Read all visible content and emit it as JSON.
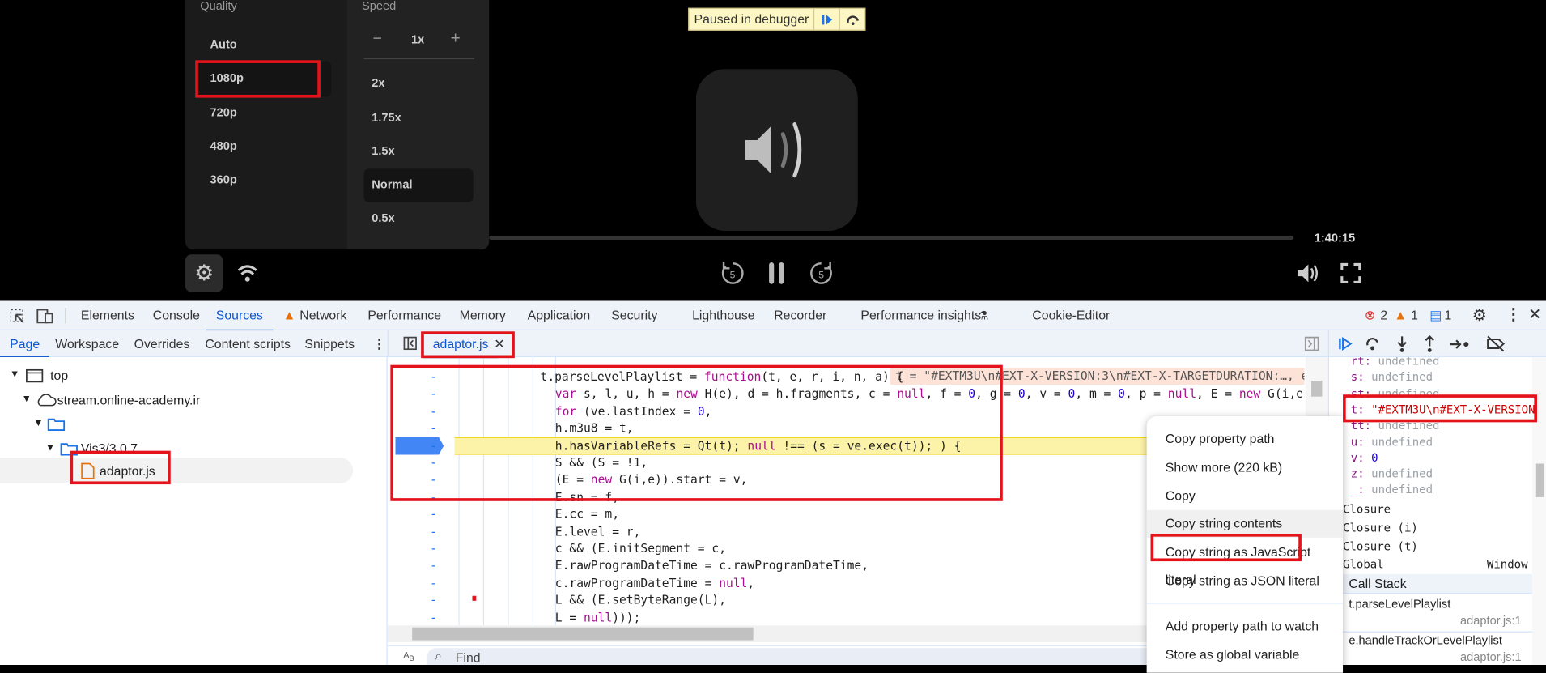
{
  "player": {
    "quality_header": "Quality",
    "speed_header": "Speed",
    "quality_options": [
      "Auto",
      "1080p",
      "720p",
      "480p",
      "360p"
    ],
    "speed_stepper": {
      "minus": "−",
      "value": "1x",
      "plus": "+"
    },
    "speed_options": [
      "2x",
      "1.75x",
      "1.5x",
      "Normal",
      "0.5x"
    ],
    "selected_quality": "1080p",
    "selected_speed": "Normal",
    "time": "1:40:15",
    "paused_label": "Paused in debugger",
    "rewind_seconds": "5",
    "forward_seconds": "5"
  },
  "devtools": {
    "tabs": [
      "Elements",
      "Console",
      "Sources",
      "Network",
      "Performance",
      "Memory",
      "Application",
      "Security",
      "Lighthouse",
      "Recorder",
      "Performance insights",
      "Cookie-Editor"
    ],
    "active_tab": "Sources",
    "errors": "2",
    "warnings": "1",
    "messages": "1",
    "nav_tabs": [
      "Page",
      "Workspace",
      "Overrides",
      "Content scripts",
      "Snippets"
    ],
    "tree": {
      "top": "top",
      "domain": "stream.online-academy.ir",
      "folder": "Vis3/3.0.7",
      "file": "adaptor.js"
    },
    "open_file": "adaptor.js",
    "inline_value": "t = \"#EXTM3U\\n#EXT-X-VERSION:3\\n#EXT-X-TARGETDURATION:…, e",
    "code": [
      [
        [
          "t.parseLevelPlaylist = ",
          ""
        ],
        [
          "function",
          "kw"
        ],
        [
          "(t, e, r, i, n, a) {",
          ""
        ]
      ],
      [
        [
          "var",
          "kw"
        ],
        [
          " s, l, u, h = ",
          ""
        ],
        [
          "new",
          "kw"
        ],
        [
          " H(e), d = h.fragments, c = ",
          ""
        ],
        [
          "null",
          "kw"
        ],
        [
          ", f = ",
          ""
        ],
        [
          "0",
          "nm"
        ],
        [
          ", g = ",
          ""
        ],
        [
          "0",
          "nm"
        ],
        [
          ", v = ",
          ""
        ],
        [
          "0",
          "nm"
        ],
        [
          ", m = ",
          ""
        ],
        [
          "0",
          "nm"
        ],
        [
          ", p = ",
          ""
        ],
        [
          "null",
          "kw"
        ],
        [
          ", E = ",
          ""
        ],
        [
          "new",
          "kw"
        ],
        [
          " G(i,e), T = ",
          ""
        ]
      ],
      [
        [
          "for",
          "kw"
        ],
        [
          " (ve.lastIndex = ",
          ""
        ],
        [
          "0",
          "nm"
        ],
        [
          ",",
          ""
        ]
      ],
      [
        [
          "h.m3u8 = t,",
          ""
        ]
      ],
      [
        [
          "h.hasVariableRefs = Qt(t); ",
          ""
        ],
        [
          "null",
          "kw"
        ],
        [
          " !== (s = ve.exec(t)); ) {",
          ""
        ]
      ],
      [
        [
          "S && (S = !1,",
          ""
        ]
      ],
      [
        [
          "(E = ",
          ""
        ],
        [
          "new",
          "kw"
        ],
        [
          " G(i,e)).start = v,",
          ""
        ]
      ],
      [
        [
          "E.sn = f,",
          ""
        ]
      ],
      [
        [
          "E.cc = m,",
          ""
        ]
      ],
      [
        [
          "E.level = r,",
          ""
        ]
      ],
      [
        [
          "c && (E.initSegment = c,",
          ""
        ]
      ],
      [
        [
          "E.rawProgramDateTime = c.rawProgramDateTime,",
          ""
        ]
      ],
      [
        [
          "c.rawProgramDateTime = ",
          ""
        ],
        [
          "null",
          "kw"
        ],
        [
          ",",
          ""
        ]
      ],
      [
        [
          "L && (E.setByteRange(L),",
          ""
        ]
      ],
      [
        [
          "L = ",
          ""
        ],
        [
          "null",
          "kw"
        ],
        [
          ")));",
          ""
        ]
      ]
    ],
    "find_placeholder": "Find",
    "scope": [
      {
        "k": "rt",
        "v": "undefined"
      },
      {
        "k": "s",
        "v": "undefined"
      },
      {
        "k": "st",
        "v": "undefined"
      },
      {
        "k": "t",
        "v": "\"#EXTM3U\\n#EXT-X-VERSION"
      },
      {
        "k": "tt",
        "v": "undefined"
      },
      {
        "k": "u",
        "v": "undefined"
      },
      {
        "k": "v",
        "v": "0"
      },
      {
        "k": "z",
        "v": "undefined"
      },
      {
        "k": "_",
        "v": "undefined"
      }
    ],
    "closures": [
      "Closure",
      "Closure (i)",
      "Closure (t)"
    ],
    "global": {
      "label": "Global",
      "value": "Window"
    },
    "call_stack_header": "Call Stack",
    "call_stack": [
      {
        "fn": "t.parseLevelPlaylist",
        "loc": "adaptor.js:1"
      },
      {
        "fn": "e.handleTrackOrLevelPlaylist",
        "loc": "adaptor.js:1"
      }
    ],
    "context_menu": [
      "Copy property path",
      "Show more (220 kB)",
      "Copy",
      "Copy string contents",
      "Copy string as JavaScript literal",
      "Copy string as JSON literal",
      "Add property path to watch",
      "Store as global variable"
    ]
  }
}
